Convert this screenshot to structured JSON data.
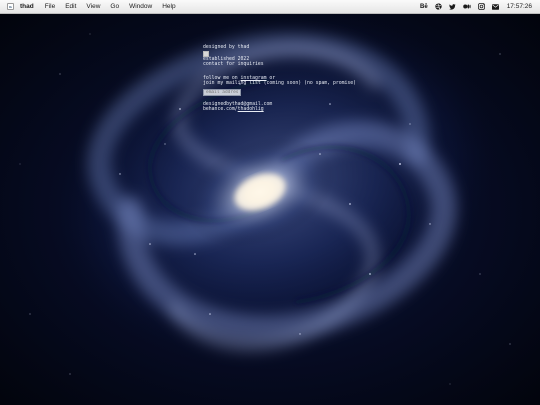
{
  "menubar": {
    "app_name": "thad",
    "items": [
      "File",
      "Edit",
      "View",
      "Go",
      "Window",
      "Help"
    ],
    "status_icons": [
      "behance-icon",
      "dribbble-icon",
      "twitter-icon",
      "medium-icon",
      "instagram-icon",
      "mail-icon"
    ],
    "behance_label": "Bē",
    "clock": "17:57:26"
  },
  "page": {
    "designed_by": "designed by thad",
    "established": "established 2022",
    "contact": "contact for inquiries",
    "follow_prefix": "follow me on ",
    "instagram_link": "instagram",
    "follow_suffix": " or",
    "mailing_line": "join my mailing list (coming soon) (no spam, promise)",
    "email_placeholder": "email address",
    "email": "designedbythad@gmail.com",
    "behance_prefix": "behance.com/",
    "behance_handle": "thadohlig"
  },
  "colors": {
    "background": "#040818",
    "text": "#e8ecf4",
    "menubar": "#f0f0f0"
  }
}
